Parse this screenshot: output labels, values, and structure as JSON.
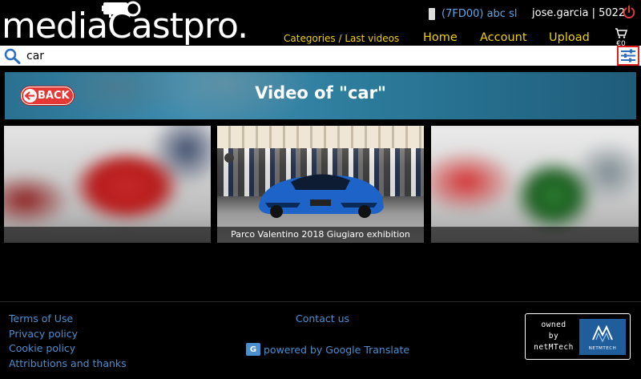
{
  "header": {
    "logo_text": "mediaCastpro.",
    "company": "(7FD00) abc sl",
    "user": "jose.garcia | 5022",
    "breadcrumb": "Categories / Last videos",
    "nav": {
      "home": "Home",
      "account": "Account",
      "upload": "Upload"
    },
    "cart_total": "€0",
    "icons": {
      "phone": "phone-icon",
      "power": "power-icon",
      "cart": "cart-icon"
    },
    "accent_color": "#f0d000"
  },
  "search": {
    "value": "car",
    "placeholder": "",
    "icons": {
      "search": "search-icon",
      "filter": "filter-sliders-icon"
    }
  },
  "banner": {
    "back_label": "BACK",
    "title": "Video of \"car\""
  },
  "videos": [
    {
      "caption": "",
      "blurred": true
    },
    {
      "caption": "Parco Valentino 2018 Giugiaro exhibition",
      "blurred": false
    },
    {
      "caption": "",
      "blurred": true
    }
  ],
  "footer": {
    "links": [
      "Terms of Use",
      "Privacy policy",
      "Cookie policy",
      "Attributions and thanks"
    ],
    "contact": "Contact us",
    "translate": "powered by Google Translate",
    "owned_lines": [
      "owned",
      "by",
      "netMTech"
    ],
    "badge_text": "NETMTECH",
    "link_color": "#4a8fd0"
  }
}
